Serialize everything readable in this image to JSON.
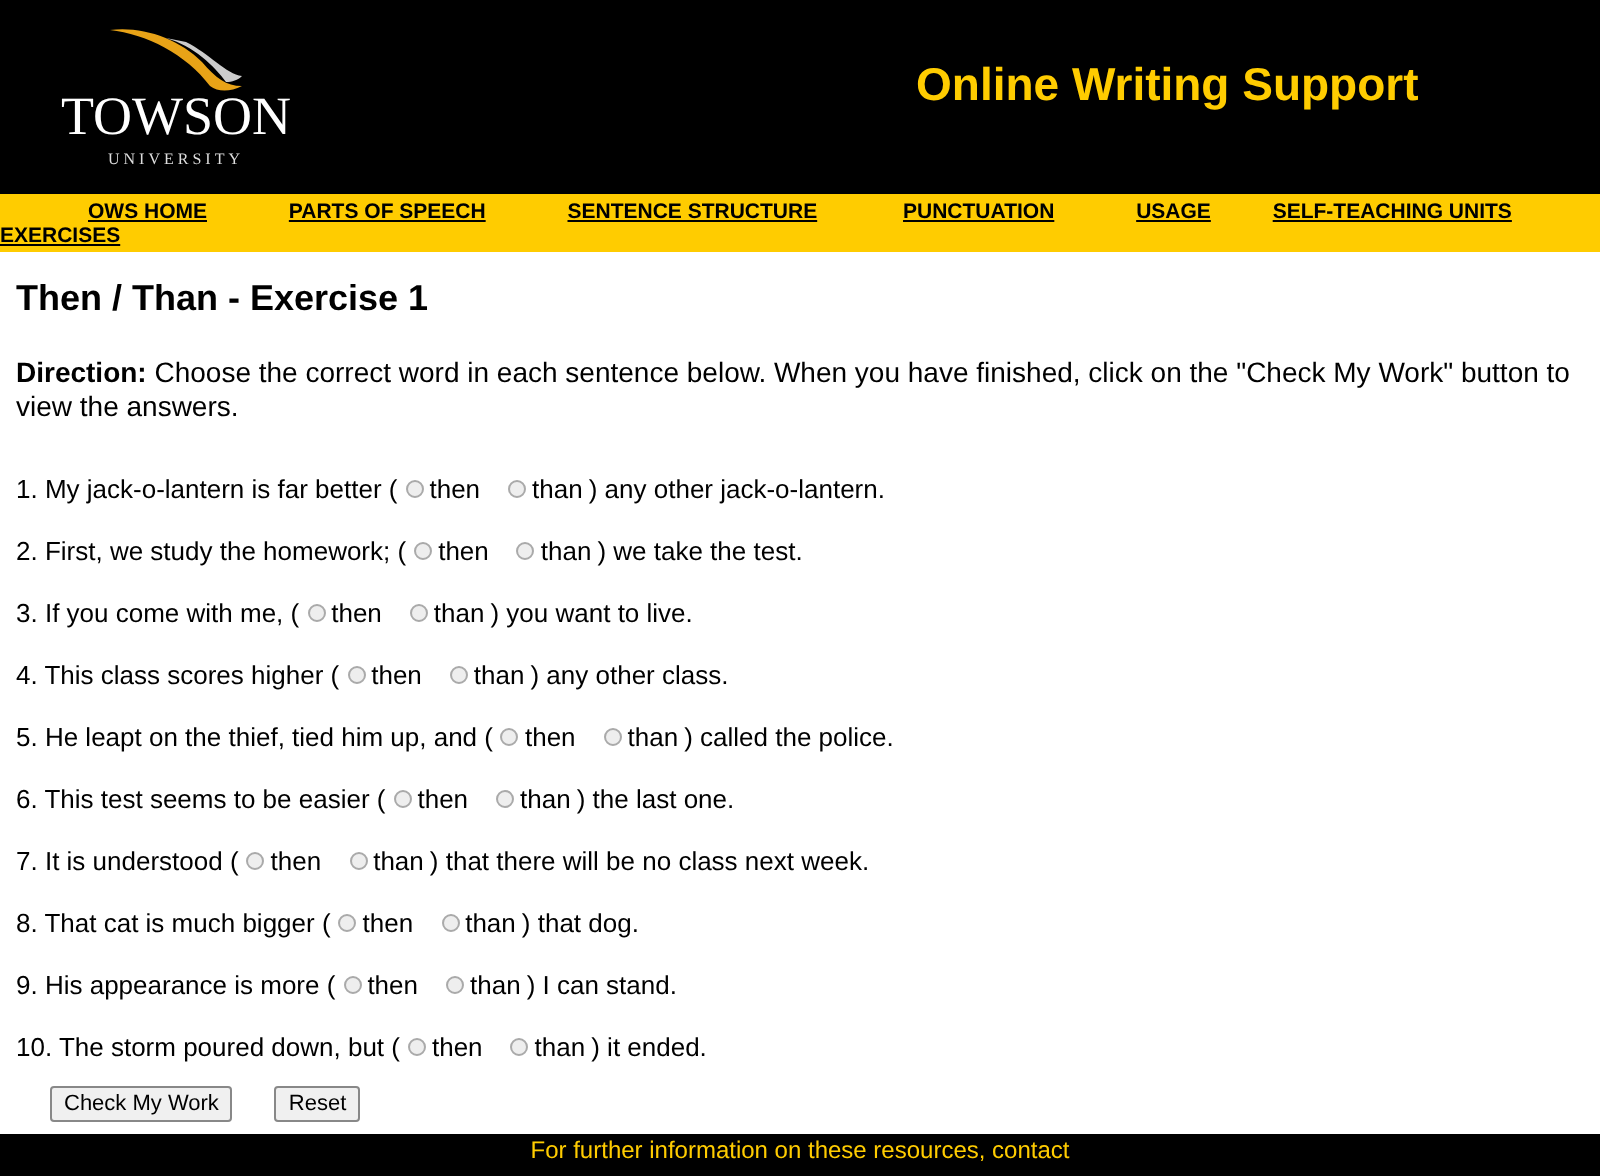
{
  "header": {
    "logo": {
      "name": "TOWSON",
      "subtitle": "UNIVERSITY"
    },
    "title": "Online Writing Support"
  },
  "nav": [
    "OWS HOME",
    "PARTS OF SPEECH",
    "SENTENCE STRUCTURE",
    "PUNCTUATION",
    "USAGE",
    "SELF-TEACHING UNITS",
    "EXERCISES"
  ],
  "page_title": "Then / Than - Exercise 1",
  "direction": {
    "label": "Direction:",
    "text": "Choose the correct word in each sentence below. When you have finished, click on the \"Check My Work\" button to view the answers."
  },
  "questions": [
    {
      "prefix": "1. My jack-o-lantern is far better (",
      "options": [
        {
          "label": "then",
          "selected": false
        },
        {
          "label": "than",
          "selected": false
        }
      ],
      "suffix": ") any other jack-o-lantern."
    },
    {
      "prefix": "2. First, we study the homework; (",
      "options": [
        {
          "label": "then",
          "selected": false
        },
        {
          "label": "than",
          "selected": false
        }
      ],
      "suffix": ") we take the test."
    },
    {
      "prefix": "3. If you come with me, (",
      "options": [
        {
          "label": "then",
          "selected": false
        },
        {
          "label": "than",
          "selected": false
        }
      ],
      "suffix": ") you want to live."
    },
    {
      "prefix": "4. This class scores higher (",
      "options": [
        {
          "label": "then",
          "selected": false
        },
        {
          "label": "than",
          "selected": false
        }
      ],
      "suffix": ") any other class."
    },
    {
      "prefix": "5. He leapt on the thief, tied him up, and (",
      "options": [
        {
          "label": "then",
          "selected": false
        },
        {
          "label": "than",
          "selected": false
        }
      ],
      "suffix": ") called the police."
    },
    {
      "prefix": "6. This test seems to be easier (",
      "options": [
        {
          "label": "then",
          "selected": false
        },
        {
          "label": "than",
          "selected": false
        }
      ],
      "suffix": ") the last one."
    },
    {
      "prefix": "7. It is understood (",
      "options": [
        {
          "label": "then",
          "selected": false
        },
        {
          "label": "than",
          "selected": false
        }
      ],
      "suffix": ") that there will be no class next week."
    },
    {
      "prefix": "8. That cat is much bigger (",
      "options": [
        {
          "label": "then",
          "selected": false
        },
        {
          "label": "than",
          "selected": false
        }
      ],
      "suffix": ") that dog."
    },
    {
      "prefix": "9. His appearance is more (",
      "options": [
        {
          "label": "then",
          "selected": false
        },
        {
          "label": "than",
          "selected": false
        }
      ],
      "suffix": ") I can stand."
    },
    {
      "prefix": "10. The storm poured down, but (",
      "options": [
        {
          "label": "then",
          "selected": false
        },
        {
          "label": "than",
          "selected": false
        }
      ],
      "suffix": ") it ended."
    }
  ],
  "buttons": [
    "Check My Work",
    "Reset"
  ],
  "footer": [
    "For further information on these resources, contact"
  ]
}
